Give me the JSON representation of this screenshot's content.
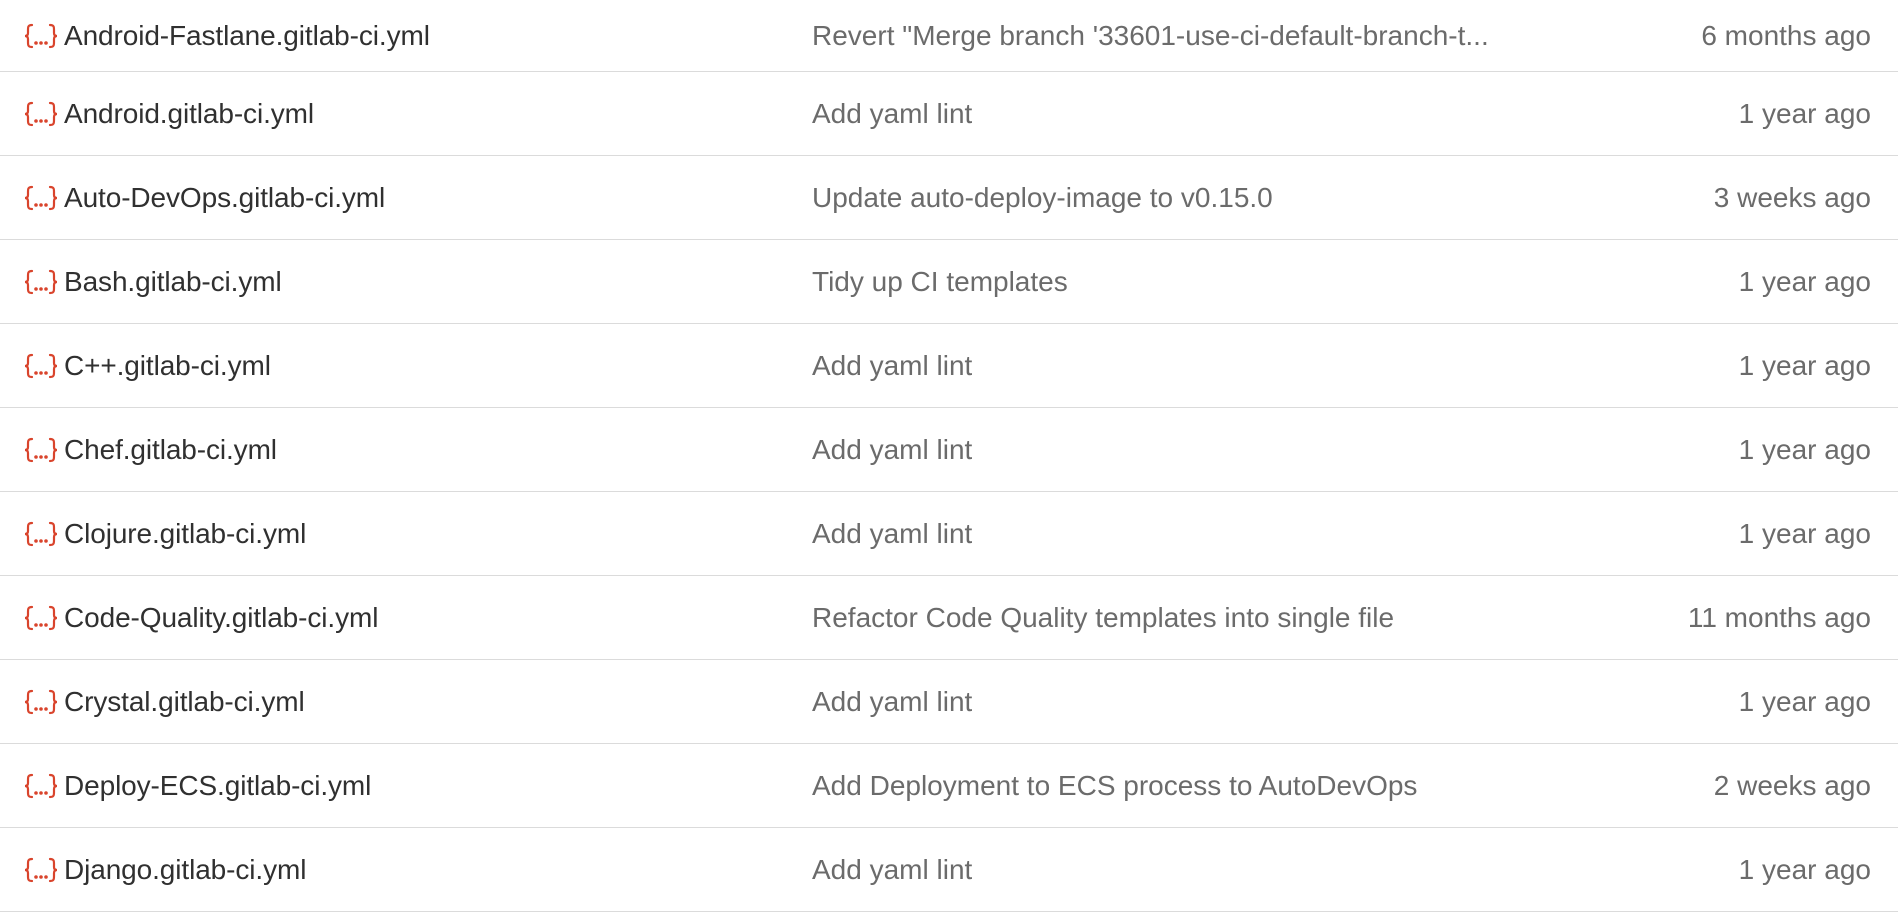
{
  "colors": {
    "icon": "#d9442c",
    "file_name": "#303030",
    "secondary_text": "#6b6b6b",
    "divider": "#dbdbdb"
  },
  "file_icon": "yaml-file-icon",
  "rows": [
    {
      "name": "Android-Fastlane.gitlab-ci.yml",
      "commit": "Revert \"Merge branch '33601-use-ci-default-branch-t...",
      "time": "6 months ago"
    },
    {
      "name": "Android.gitlab-ci.yml",
      "commit": "Add yaml lint",
      "time": "1 year ago"
    },
    {
      "name": "Auto-DevOps.gitlab-ci.yml",
      "commit": "Update auto-deploy-image to v0.15.0",
      "time": "3 weeks ago"
    },
    {
      "name": "Bash.gitlab-ci.yml",
      "commit": "Tidy up CI templates",
      "time": "1 year ago"
    },
    {
      "name": "C++.gitlab-ci.yml",
      "commit": "Add yaml lint",
      "time": "1 year ago"
    },
    {
      "name": "Chef.gitlab-ci.yml",
      "commit": "Add yaml lint",
      "time": "1 year ago"
    },
    {
      "name": "Clojure.gitlab-ci.yml",
      "commit": "Add yaml lint",
      "time": "1 year ago"
    },
    {
      "name": "Code-Quality.gitlab-ci.yml",
      "commit": "Refactor Code Quality templates into single file",
      "time": "11 months ago"
    },
    {
      "name": "Crystal.gitlab-ci.yml",
      "commit": "Add yaml lint",
      "time": "1 year ago"
    },
    {
      "name": "Deploy-ECS.gitlab-ci.yml",
      "commit": "Add Deployment to ECS process to AutoDevOps",
      "time": "2 weeks ago"
    },
    {
      "name": "Django.gitlab-ci.yml",
      "commit": "Add yaml lint",
      "time": "1 year ago"
    }
  ]
}
